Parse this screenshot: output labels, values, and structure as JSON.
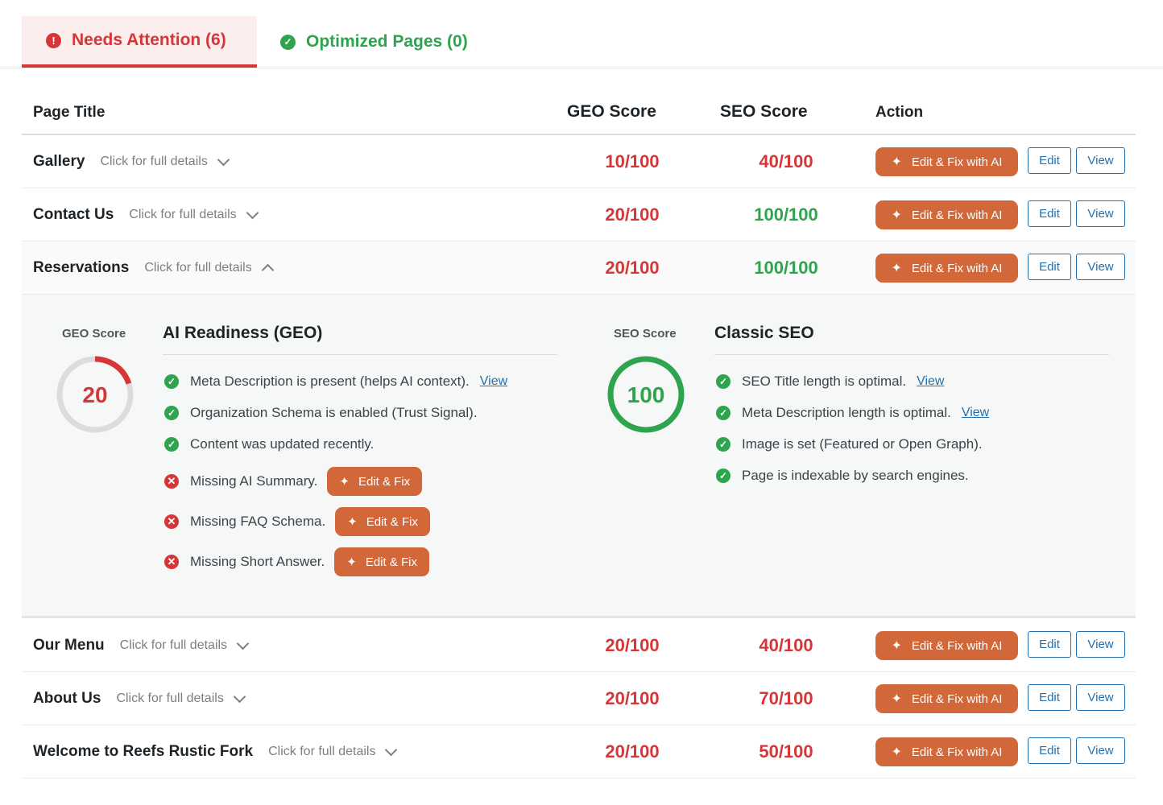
{
  "tabs": [
    {
      "label": "Needs Attention (6)",
      "icon": "exclamation-circle-icon",
      "active": true
    },
    {
      "label": "Optimized Pages (0)",
      "icon": "check-circle-icon",
      "active": false
    }
  ],
  "table": {
    "headers": {
      "title": "Page Title",
      "geo": "GEO Score",
      "seo": "SEO Score",
      "action": "Action"
    },
    "details_label": "Click for full details",
    "actions": {
      "ai_fix": "Edit & Fix with AI",
      "edit": "Edit",
      "view": "View"
    },
    "rows": [
      {
        "title": "Gallery",
        "geo": "10/100",
        "seo": "40/100",
        "expanded": false
      },
      {
        "title": "Contact Us",
        "geo": "20/100",
        "seo": "100/100",
        "expanded": false
      },
      {
        "title": "Reservations",
        "geo": "20/100",
        "seo": "100/100",
        "expanded": true
      },
      {
        "title": "Our Menu",
        "geo": "20/100",
        "seo": "40/100",
        "expanded": false
      },
      {
        "title": "About Us",
        "geo": "20/100",
        "seo": "70/100",
        "expanded": false
      },
      {
        "title": "Welcome to Reefs Rustic Fork",
        "geo": "20/100",
        "seo": "50/100",
        "expanded": false
      }
    ]
  },
  "details": {
    "geo": {
      "score_label": "GEO Score",
      "score": "20",
      "score_fraction": 0.2,
      "title": "AI Readiness (GEO)",
      "items": [
        {
          "status": "ok",
          "text": "Meta Description is present (helps AI context).",
          "link": "View"
        },
        {
          "status": "ok",
          "text": "Organization Schema is enabled (Trust Signal)."
        },
        {
          "status": "ok",
          "text": "Content was updated recently."
        },
        {
          "status": "bad",
          "text": "Missing AI Summary.",
          "button": "Edit & Fix"
        },
        {
          "status": "bad",
          "text": "Missing FAQ Schema.",
          "button": "Edit & Fix"
        },
        {
          "status": "bad",
          "text": "Missing Short Answer.",
          "button": "Edit & Fix"
        }
      ]
    },
    "seo": {
      "score_label": "SEO Score",
      "score": "100",
      "score_fraction": 1.0,
      "title": "Classic SEO",
      "items": [
        {
          "status": "ok",
          "text": "SEO Title length is optimal.",
          "link": "View"
        },
        {
          "status": "ok",
          "text": "Meta Description length is optimal.",
          "link": "View"
        },
        {
          "status": "ok",
          "text": "Image is set (Featured or Open Graph)."
        },
        {
          "status": "ok",
          "text": "Page is indexable by search engines."
        }
      ]
    }
  },
  "colors": {
    "danger": "#d63638",
    "success": "#2ea44f",
    "accent": "#d2683a",
    "link": "#2271b1"
  }
}
